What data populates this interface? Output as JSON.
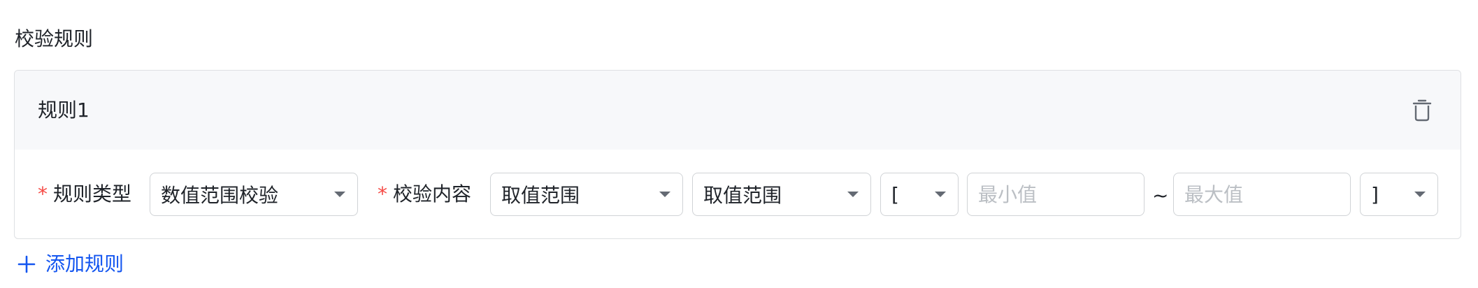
{
  "section": {
    "title": "校验规则"
  },
  "rule": {
    "title": "规则1",
    "rule_type": {
      "label": "规则类型",
      "value": "数值范围校验"
    },
    "check_content": {
      "label": "校验内容",
      "field_value": "取值范围",
      "operator_value": "取值范围",
      "left_bracket": "[",
      "min_placeholder": "最小值",
      "separator": "~",
      "max_placeholder": "最大值",
      "right_bracket": "]"
    }
  },
  "actions": {
    "add_rule_label": "添加规则"
  },
  "colors": {
    "accent": "#1456f0",
    "required": "#f54a45",
    "header_bg": "#f7f8fa",
    "border": "#dee0e3"
  },
  "icons": {
    "delete": "trash-icon",
    "add": "plus-icon",
    "dropdown": "caret-down-icon"
  }
}
